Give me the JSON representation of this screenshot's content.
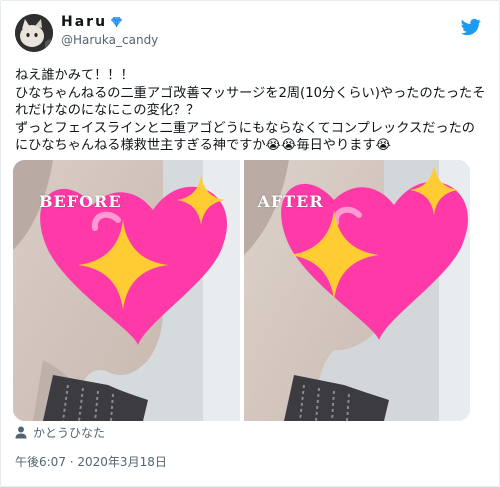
{
  "user": {
    "display_name": "Haru",
    "username": "@Haruka_candy",
    "verified_icon": "blue-diamond",
    "avatar": "cat-photo"
  },
  "tweet": {
    "lines": [
      "ねえ誰かみて！！！",
      "ひなちゃんねるの二重アゴ改善マッサージを2周(10分くらい)やったのたったそれだけなのになにこの変化？？",
      "ずっとフェイスラインと二重アゴどうにもならなくてコンプレックスだったのにひなちゃんねる様救世主すぎる神ですか😭😭毎日やります😭"
    ]
  },
  "media": {
    "before_label": "BEFORE",
    "after_label": "AFTER",
    "decorations": [
      "pink-heart",
      "sparkles"
    ]
  },
  "tagged_user": "かとうひなた",
  "timestamp": "午後6:07 · 2020年3月18日",
  "colors": {
    "secondary_text": "#536471",
    "verified": "#1d9bf0",
    "heart": "#ff3aa8",
    "sparkle": "#ffcc33"
  }
}
